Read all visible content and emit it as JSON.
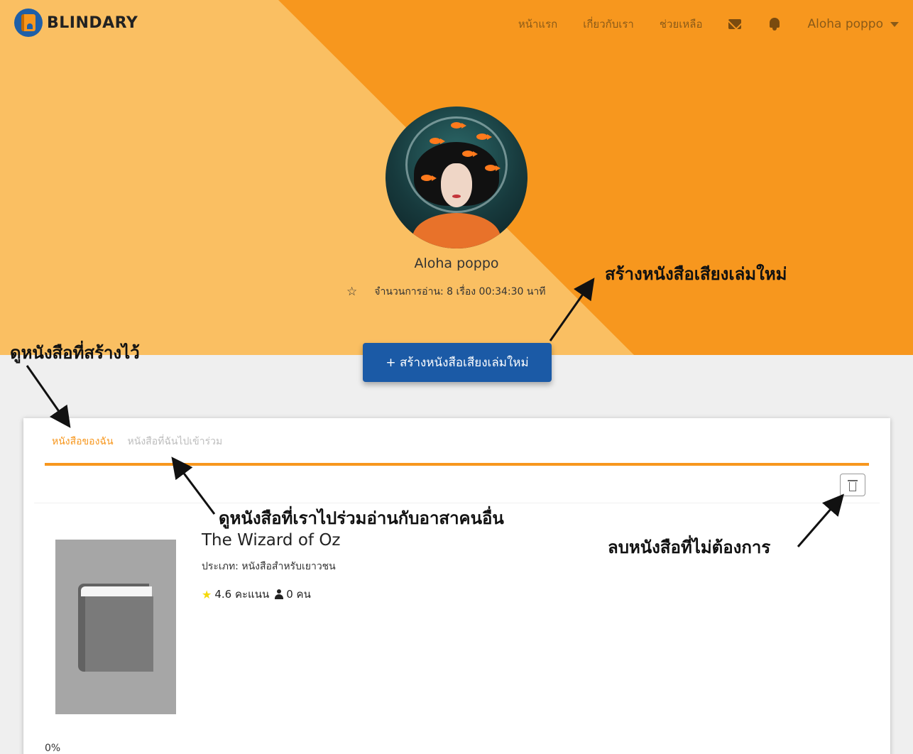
{
  "navbar": {
    "brand": "BLINDARY",
    "links": [
      "หน้าแรก",
      "เกี่ยวกับเรา",
      "ช่วยเหลือ"
    ],
    "icons": [
      "envelope-icon",
      "bell-icon"
    ],
    "user": "Aloha poppo"
  },
  "colors": {
    "hero_light": "#fabf62",
    "hero_dark": "#f7971e",
    "primary_button": "#1b5aa6",
    "tab_accent": "#f7971e"
  },
  "profile": {
    "name": "Aloha poppo",
    "stats": "จำนวนการอ่าน: 8 เรื่อง 00:34:30 นาที"
  },
  "create_button": "+ สร้างหนังสือเสียงเล่มใหม่",
  "tabs": {
    "my_books": "หนังสือของฉัน",
    "joined_books": "หนังสือที่ฉันไปเข้าร่วม"
  },
  "book": {
    "title": "The Wizard of Oz",
    "category": "ประเภท: หนังสือสำหรับเยาวชน",
    "rating": "4.6 คะแนน",
    "readers": "0 คน",
    "progress": "0%"
  },
  "annotations": {
    "create": "สร้างหนังสือเสียงเล่มใหม่",
    "my_books": "ดูหนังสือที่สร้างไว้",
    "joined": "ดูหนังสือที่เราไปร่วมอ่านกับอาสาคนอื่น",
    "delete": "ลบหนังสือที่ไม่ต้องการ"
  }
}
